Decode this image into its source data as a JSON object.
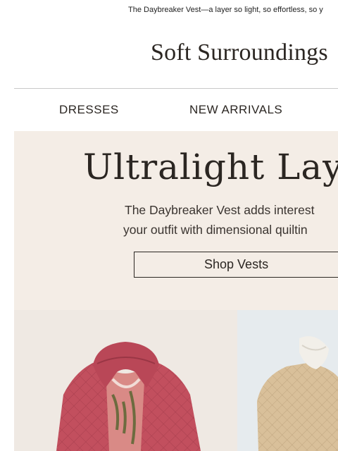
{
  "preheader": "The Daybreaker Vest—a layer so light, so effortless, so y",
  "brand": {
    "logo_text": "Soft Surroundings"
  },
  "nav": [
    {
      "label": "DRESSES"
    },
    {
      "label": "NEW ARRIVALS"
    }
  ],
  "hero": {
    "title": "Ultralight Layer",
    "copy_line1": "The Daybreaker Vest adds interest",
    "copy_line2": "your outfit with dimensional quiltin",
    "cta_label": "Shop Vests"
  },
  "colors": {
    "hero_bg": "#f4ede6",
    "text": "#2b2622",
    "vest_rose": "#c0505e",
    "vest_tan": "#d8bf98"
  },
  "images": [
    {
      "name": "pink-quilted-vest-photo"
    },
    {
      "name": "tan-quilted-vest-photo"
    }
  ]
}
